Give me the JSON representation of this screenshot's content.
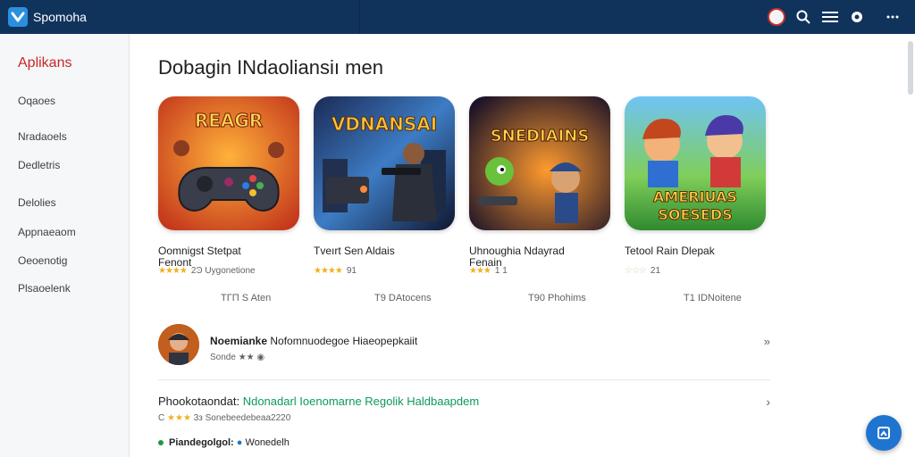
{
  "header": {
    "brand": "Spomoha",
    "icons": [
      "profile-badge-icon",
      "search-icon",
      "menu-icon",
      "settings-icon",
      "more-dots-icon"
    ],
    "colors": {
      "bar": "#10335c",
      "logo": "#2b8fe0"
    }
  },
  "sidebar": {
    "title": "Aplikans",
    "items": [
      "Oqaoes",
      "Nradaoels",
      "Dedletris",
      "Delolies",
      "Appnaeaom",
      "Oeoenotig",
      "Plsaoelenk"
    ]
  },
  "main": {
    "section_title": "Dobagin INdaoliansiı men",
    "cards": [
      {
        "title": "Oomnigst Stetpat",
        "subtitle": "Fenont",
        "stars": "★★★★",
        "rating_text": "2Ͽ Uygonetione",
        "installs": "ΤΓΠ S Aten",
        "art_text": "REAGR"
      },
      {
        "title": "Tveırt Sen Aldais",
        "subtitle": "",
        "stars": "★★★★",
        "rating_text": "91",
        "installs": "Τ9 DAtocens",
        "art_text": "VDNANSAI"
      },
      {
        "title": "Uhnoughia Ndayrad",
        "subtitle": "Fenain",
        "stars": "★★★",
        "rating_text": "1 1",
        "installs": "Τ90 Phohims",
        "art_text": "SNEDIAINS"
      },
      {
        "title": "Tetool Rain Dlepak",
        "subtitle": "",
        "stars": "☆☆☆",
        "rating_text": "21",
        "installs": "Τ1 IDNoitene",
        "art_text": "AMERIUAS SOESEDS"
      }
    ],
    "feature": {
      "name": "Noemianke",
      "description": "Nofomnuodegoe Hiaeopepkaiit",
      "meta": "Sonde  ★★",
      "more": "»"
    },
    "promo": {
      "title": "Phookotaondat:",
      "highlight": "Ndonadarl Ioenomarne Regolik Haldbaapdem",
      "rating_num": "Ϲ",
      "stars": "★★★",
      "rating_text": "3ᴈ  Sonebeedebeaa2220",
      "chevron": "›"
    },
    "status": {
      "label": "Piandegolgol:",
      "value": "Wonedelh"
    }
  },
  "fab": {
    "icon": "bookmark-icon",
    "color": "#1f74cf"
  }
}
